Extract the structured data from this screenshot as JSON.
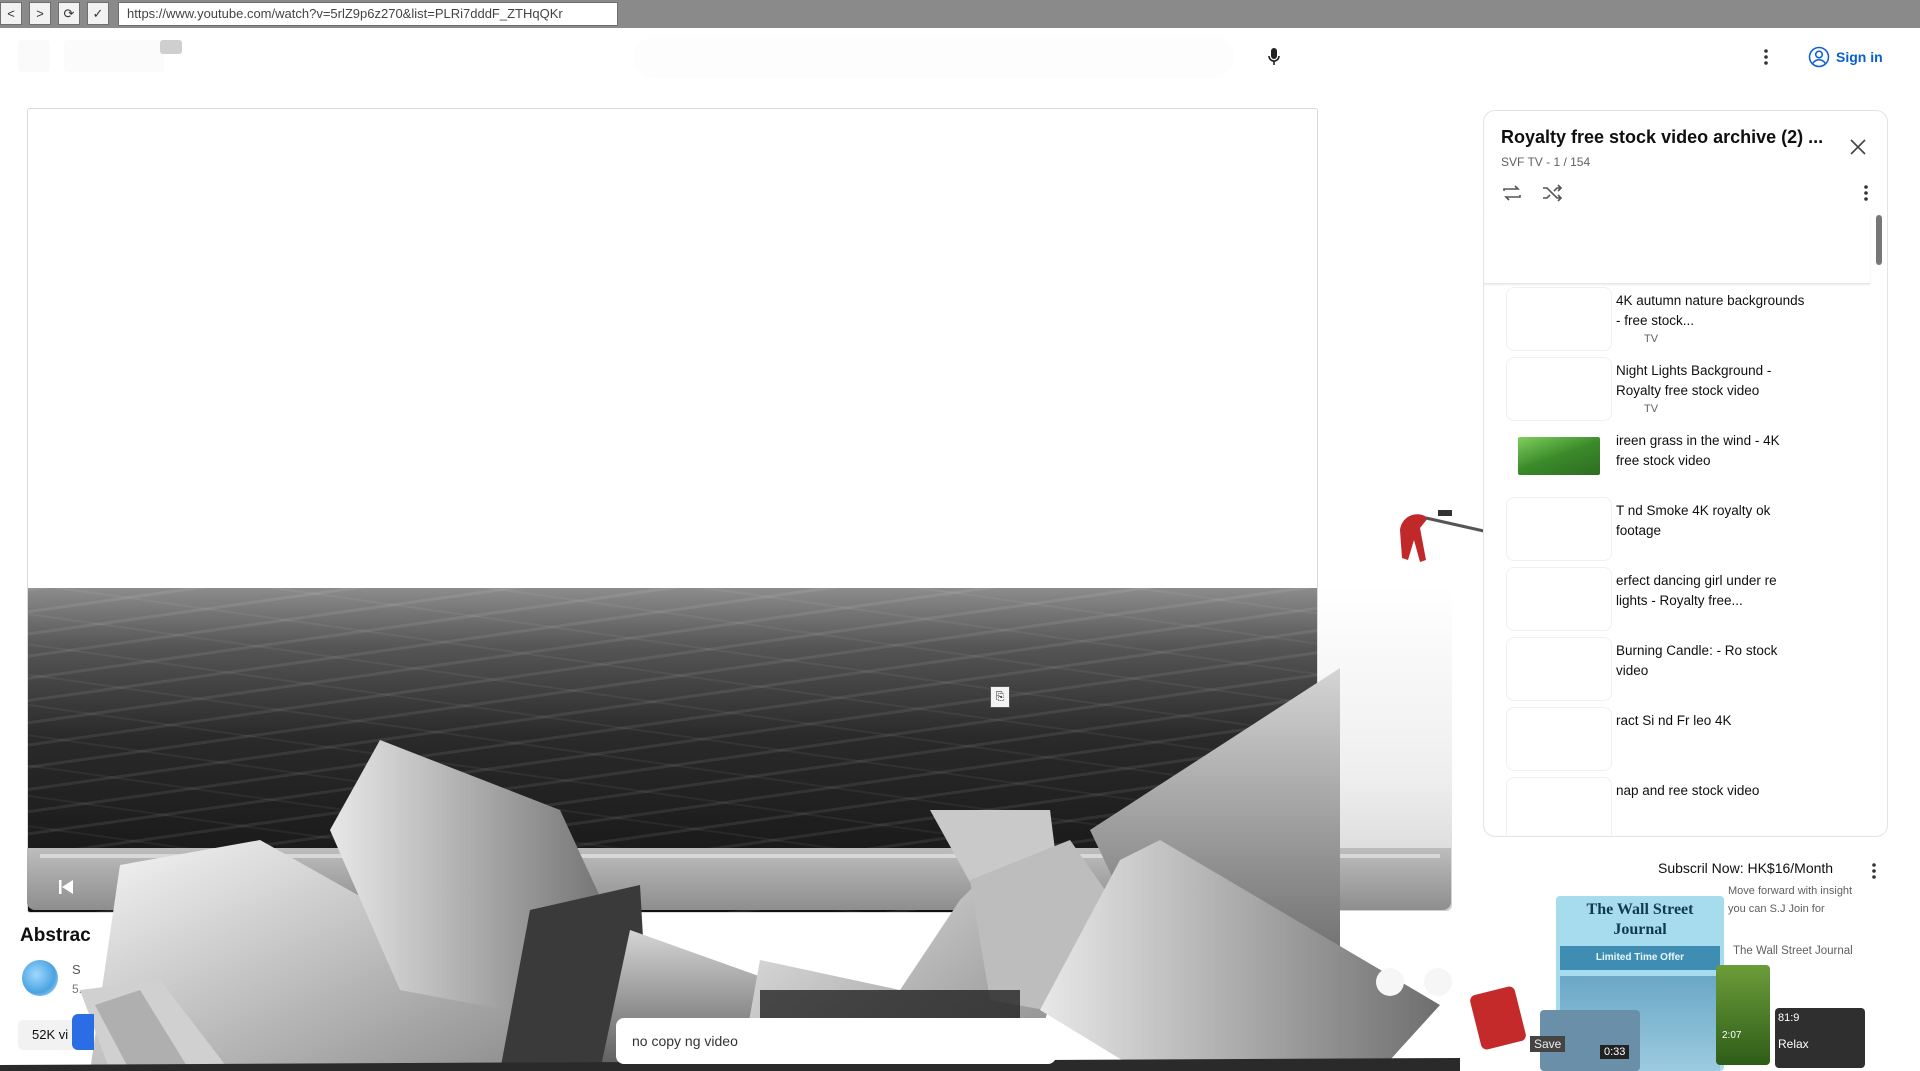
{
  "browser": {
    "back": "<",
    "forward": ">",
    "reload": "⟳",
    "check": "✓",
    "url": "https://www.youtube.com/watch?v=5rlZ9p6z270&list=PLRi7dddF_ZTHqQKr"
  },
  "header": {
    "sign_in": "Sign in"
  },
  "video": {
    "title": "Abstrac",
    "channel_initial": "S",
    "channel_sub": "5.",
    "views": "52K vi",
    "description_snippet": "no copy         ng video",
    "cursor_glyph": "⎘"
  },
  "playlist": {
    "title": "Royalty free stock video archive (2) ...",
    "subtitle": "SVF TV - 1 / 154",
    "items": [
      {
        "text": "4K autumn nature backgrounds - free stock...",
        "channel": "TV"
      },
      {
        "text": "Night Lights Background - Royalty free stock video",
        "channel": "TV"
      },
      {
        "text": "ireen grass in the wind - 4K free stock video",
        "channel": ""
      },
      {
        "text": "T   nd Smoke 4K royalty       ok footage",
        "channel": ""
      },
      {
        "text": "      erfect dancing girl under    re  lights - Royalty free...",
        "channel": ""
      },
      {
        "text": "Burning Candle:  -  Ro   stock video",
        "channel": ""
      },
      {
        "text": "       ract Si             nd          Fr               leo 4K",
        "channel": ""
      },
      {
        "text": "              nap and             ree stock video",
        "channel": ""
      }
    ]
  },
  "ad": {
    "cta": "Subscril    Now: HK$16/Month",
    "body": "Move forward with insight you can  S.J  Join for",
    "source": "The Wall Street Journal",
    "brand_line1": "The Wall Street",
    "brand_line2": "Journal",
    "offer": "Limited Time Offer"
  },
  "overlay_labels": {
    "save": "Save",
    "duration": "0:33",
    "relax": "Relax",
    "time2": "81:9",
    "side_time": "2:07"
  },
  "colors": {
    "accent_blue": "#065fd4",
    "chrome_gray": "#8a8a8a",
    "wsj_bg": "#a7dcef",
    "wsj_band": "#3f8db3"
  }
}
